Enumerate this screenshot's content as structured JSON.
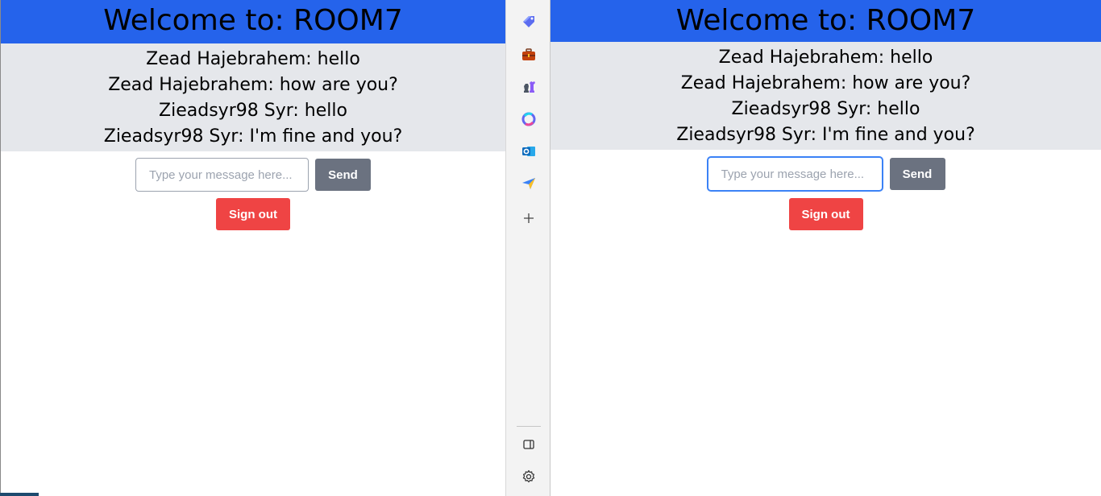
{
  "left_pane": {
    "header": "Welcome to: ROOM7",
    "messages": [
      "Zead Hajebrahem: hello",
      "Zead Hajebrahem: how are you?",
      "Zieadsyr98 Syr: hello",
      "Zieadsyr98 Syr: I'm fine and you?"
    ],
    "input_placeholder": "Type your message here...",
    "input_value": "",
    "send_label": "Send",
    "signout_label": "Sign out"
  },
  "right_pane": {
    "header": "Welcome to: ROOM7",
    "messages": [
      "Zead Hajebrahem: hello",
      "Zead Hajebrahem: how are you?",
      "Zieadsyr98 Syr: hello",
      "Zieadsyr98 Syr: I'm fine and you?"
    ],
    "input_placeholder": "Type your message here...",
    "input_value": "",
    "send_label": "Send",
    "signout_label": "Sign out"
  },
  "sidebar": {
    "icons": [
      "tag-icon",
      "briefcase-icon",
      "chess-icon",
      "copilot-icon",
      "outlook-icon",
      "send-icon",
      "add-icon",
      "sidebar-toggle-icon",
      "settings-icon"
    ]
  },
  "colors": {
    "header_bg": "#2563eb",
    "messages_bg": "#e5e7eb",
    "send_bg": "#6b7280",
    "signout_bg": "#ef4444",
    "focus_border": "#3b82f6"
  }
}
